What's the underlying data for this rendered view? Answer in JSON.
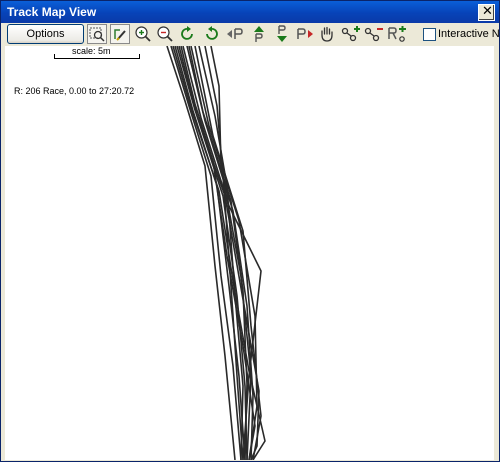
{
  "window": {
    "title": "Track Map View"
  },
  "toolbar": {
    "options_label": "Options",
    "tools": [
      {
        "icon": "zoom-region-icon"
      },
      {
        "icon": "edit-track-icon"
      },
      {
        "icon": "zoom-in-icon"
      },
      {
        "icon": "zoom-out-icon"
      },
      {
        "icon": "rotate-right-icon"
      },
      {
        "icon": "rotate-left-icon"
      },
      {
        "icon": "previous-point-icon"
      },
      {
        "icon": "point-up-icon"
      },
      {
        "icon": "point-down-icon"
      },
      {
        "icon": "next-point-icon"
      },
      {
        "icon": "pan-hand-icon"
      },
      {
        "icon": "add-node-icon"
      },
      {
        "icon": "remove-node-icon"
      },
      {
        "icon": "add-region-icon"
      }
    ],
    "interactive_label": "Interactive N",
    "interactive_checked": false
  },
  "map": {
    "scale_label": "scale: 5m",
    "run_info": "R: 206 Race, 0.00 to 27:20.72",
    "track_color": "#2a2a2a"
  }
}
